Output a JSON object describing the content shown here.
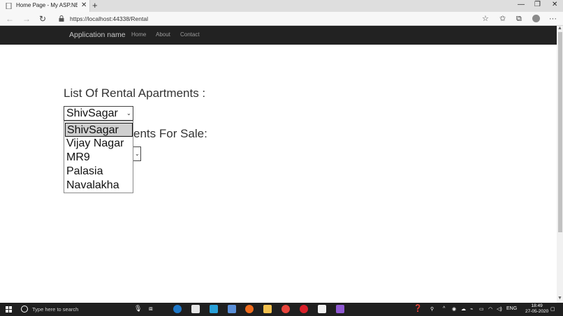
{
  "browser": {
    "tab_title": "Home Page - My ASP.NET Appli",
    "url": "https://localhost:44338/Rental"
  },
  "navbar": {
    "brand": "Application name",
    "links": [
      "Home",
      "About",
      "Contact"
    ]
  },
  "page": {
    "heading_rental": "List Of Rental Apartments :",
    "heading_sale_visible": "ents For Sale:",
    "rental_select": {
      "selected": "ShivSagar",
      "options": [
        "ShivSagar",
        "Vijay Nagar",
        "MR9",
        "Palasia",
        "Navalakha"
      ]
    }
  },
  "taskbar": {
    "search_placeholder": "Type here to search",
    "language": "ENG",
    "time": "18:49",
    "date": "27-05-2020"
  },
  "colors": {
    "navbar_bg": "#222222",
    "taskbar_bg": "#1f1f1f",
    "dropdown_selected_bg": "#cfcfcf"
  }
}
